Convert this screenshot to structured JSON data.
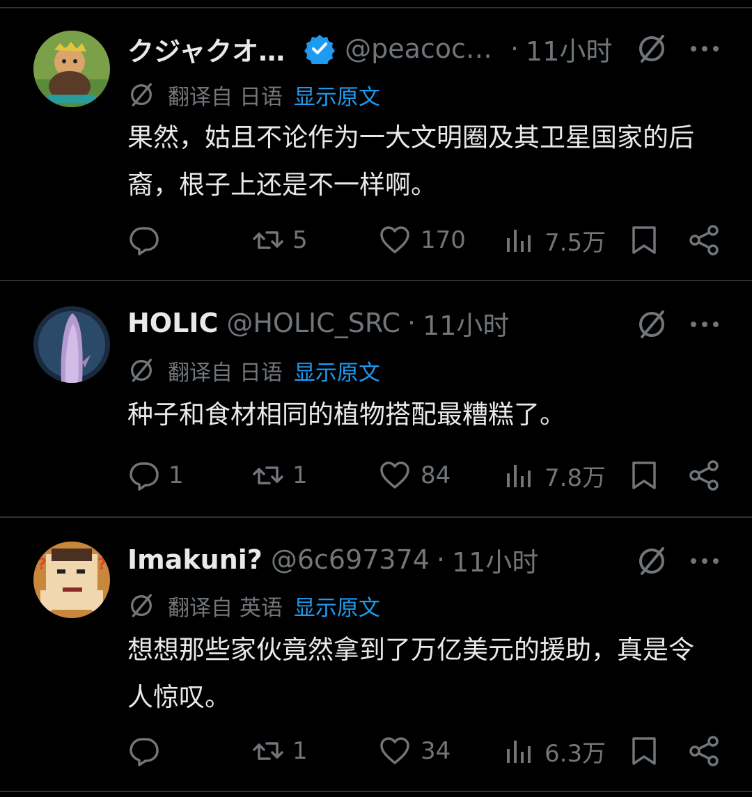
{
  "tweets": [
    {
      "name": "クジャクオ…",
      "verified": true,
      "handle": "@peacoc…",
      "dot": "·",
      "time": "11小时",
      "translated_from": "翻译自 日语",
      "show_original": "显示原文",
      "text": "果然，姑且不论作为一大文明圈及其卫星国家的后裔，根子上还是不一样啊。",
      "replies": "",
      "retweets": "5",
      "likes": "170",
      "views": "7.5万"
    },
    {
      "name": "HOLIC",
      "verified": false,
      "handle": "@HOLIC_SRC",
      "dot": "·",
      "time": "11小时",
      "translated_from": "翻译自 日语",
      "show_original": "显示原文",
      "text": "种子和食材相同的植物搭配最糟糕了。",
      "replies": "1",
      "retweets": "1",
      "likes": "84",
      "views": "7.8万"
    },
    {
      "name": "Imakuni?",
      "verified": false,
      "handle": "@6c697374",
      "dot": "·",
      "time": "11小时",
      "translated_from": "翻译自 英语",
      "show_original": "显示原文",
      "text": "想想那些家伙竟然拿到了万亿美元的援助，真是令人惊叹。",
      "replies": "",
      "retweets": "1",
      "likes": "34",
      "views": "6.3万"
    }
  ],
  "icons": {
    "verified": "verified-badge-icon",
    "grok": "grok-icon",
    "more": "more-icon",
    "translate": "translate-icon",
    "reply": "reply-icon",
    "retweet": "retweet-icon",
    "like": "like-icon",
    "views": "views-icon",
    "bookmark": "bookmark-icon",
    "share": "share-icon"
  },
  "colors": {
    "background": "#000000",
    "text": "#e7e9ea",
    "muted": "#71767b",
    "link": "#1d9bf0",
    "divider": "#2f3336"
  }
}
